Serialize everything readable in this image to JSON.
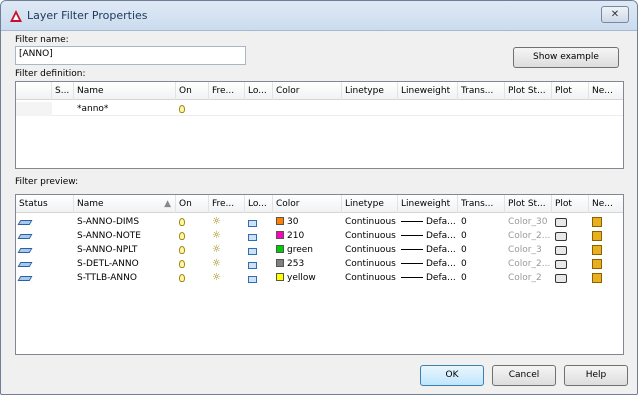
{
  "window": {
    "title": "Layer Filter Properties",
    "close": "✕"
  },
  "filter_name": {
    "label": "Filter name:",
    "value": "[ANNO]"
  },
  "show_example": "Show example",
  "filter_definition": {
    "label": "Filter definition:",
    "columns": [
      "S...",
      "Name",
      "On",
      "Fre...",
      "Lo...",
      "Color",
      "Linetype",
      "Lineweight",
      "Trans...",
      "Plot St...",
      "Plot",
      "Ne..."
    ],
    "name_value": "*anno*"
  },
  "filter_preview": {
    "label": "Filter preview:",
    "columns": [
      "Status",
      "Name",
      "On",
      "Fre...",
      "Lo...",
      "Color",
      "Linetype",
      "Lineweight",
      "Trans...",
      "Plot St...",
      "Plot",
      "Ne..."
    ],
    "rows": [
      {
        "name": "S-ANNO-DIMS",
        "color_name": "30",
        "color_hex": "#ff7f00",
        "linetype": "Continuous",
        "lineweight": "Defa...",
        "trans": "0",
        "plotstyle": "Color_30"
      },
      {
        "name": "S-ANNO-NOTE",
        "color_name": "210",
        "color_hex": "#ff00bf",
        "linetype": "Continuous",
        "lineweight": "Defa...",
        "trans": "0",
        "plotstyle": "Color_2..."
      },
      {
        "name": "S-ANNO-NPLT",
        "color_name": "green",
        "color_hex": "#00cc00",
        "linetype": "Continuous",
        "lineweight": "Defa...",
        "trans": "0",
        "plotstyle": "Color_3"
      },
      {
        "name": "S-DETL-ANNO",
        "color_name": "253",
        "color_hex": "#808080",
        "linetype": "Continuous",
        "lineweight": "Defa...",
        "trans": "0",
        "plotstyle": "Color_2..."
      },
      {
        "name": "S-TTLB-ANNO",
        "color_name": "yellow",
        "color_hex": "#ffff00",
        "linetype": "Continuous",
        "lineweight": "Defa...",
        "trans": "0",
        "plotstyle": "Color_2"
      }
    ]
  },
  "buttons": {
    "ok": "OK",
    "cancel": "Cancel",
    "help": "Help"
  }
}
